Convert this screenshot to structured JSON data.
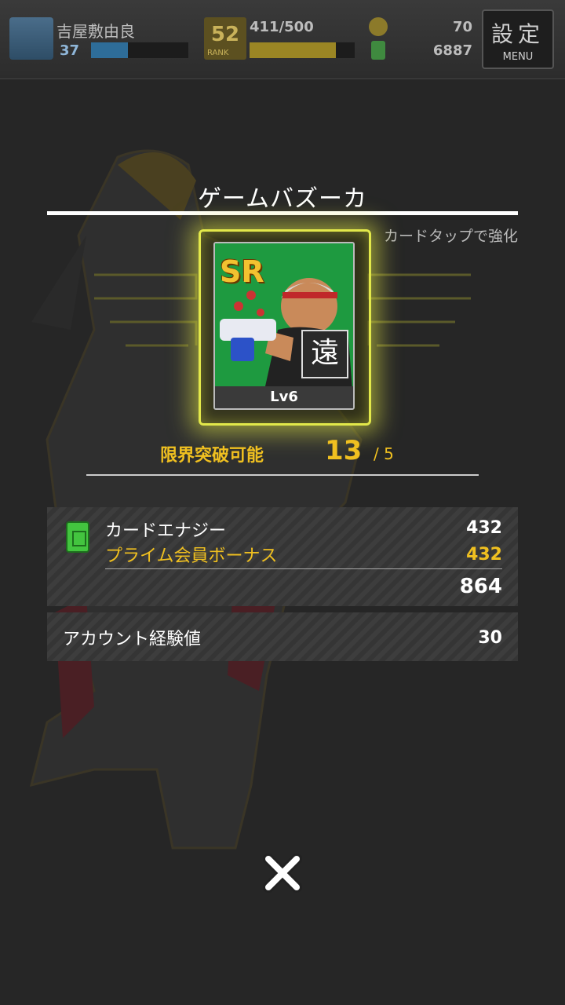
{
  "header": {
    "player_name": "吉屋敷由良",
    "player_level": "37",
    "exp_fraction": 0.38,
    "rank": "52",
    "rank_label": "RANK",
    "stamina": "411/500",
    "stamina_fraction": 0.82,
    "coins": "70",
    "energy": "6887",
    "settings_label": "設定",
    "menu_label": "MENU"
  },
  "modal": {
    "title": "ゲームバズーカ",
    "hint": "カードタップで強化",
    "card": {
      "rarity": "SR",
      "type": "遠",
      "level": "Lv6"
    },
    "limit_break": {
      "label": "限界突破可能",
      "value": "13",
      "max": "/ 5"
    },
    "energy_panel": {
      "card_energy_label": "カードエナジー",
      "card_energy_value": "432",
      "bonus_label": "プライム会員ボーナス",
      "bonus_value": "432",
      "total": "864"
    },
    "account_exp": {
      "label": "アカウント経験値",
      "value": "30"
    }
  },
  "icons": {
    "close": "close-icon",
    "energy": "energy-can-icon",
    "coin": "coin-icon"
  },
  "colors": {
    "accent_gold": "#f0c020",
    "card_glow": "#e2e84a",
    "card_green": "#1fa045"
  }
}
